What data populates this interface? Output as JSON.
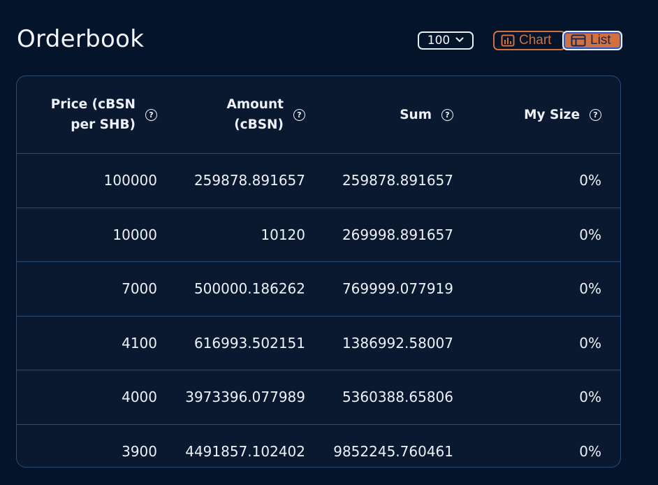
{
  "header": {
    "title": "Orderbook",
    "depth_value": "100",
    "chart_label": "Chart",
    "list_label": "List"
  },
  "table": {
    "columns": [
      "Price (cBSN\nper SHB)",
      "Amount\n(cBSN)",
      "Sum",
      "My Size"
    ],
    "rows": [
      [
        "100000",
        "259878.891657",
        "259878.891657",
        "0%"
      ],
      [
        "10000",
        "10120",
        "269998.891657",
        "0%"
      ],
      [
        "7000",
        "500000.186262",
        "769999.077919",
        "0%"
      ],
      [
        "4100",
        "616993.502151",
        "1386992.58007",
        "0%"
      ],
      [
        "4000",
        "3973396.077989",
        "5360388.65806",
        "0%"
      ],
      [
        "3900",
        "4491857.102402",
        "9852245.760461",
        "0%"
      ]
    ]
  },
  "colors": {
    "background": "#04142a",
    "accent": "#d2703f",
    "border": "#2c4a78"
  },
  "icons": [
    "chevron-down-icon",
    "bar-chart-icon",
    "table-list-icon",
    "help-icon"
  ]
}
